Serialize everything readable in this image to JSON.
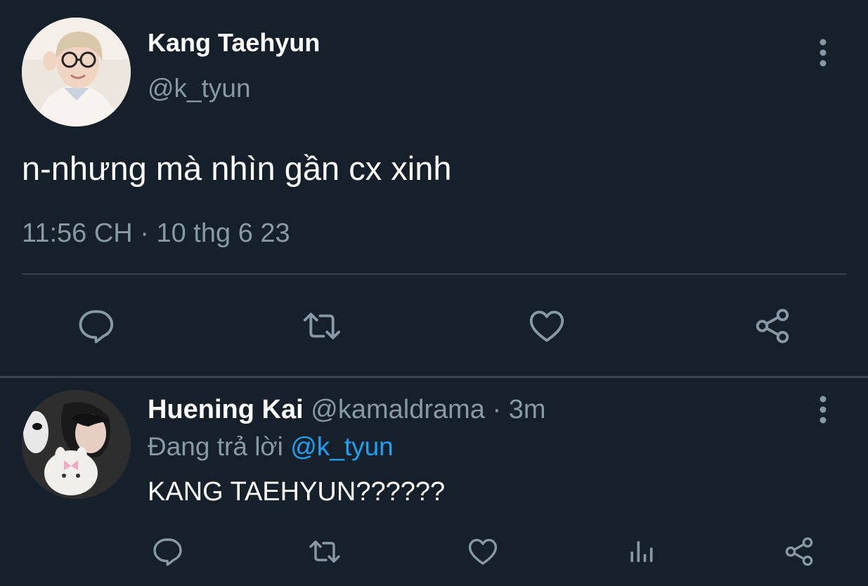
{
  "main_tweet": {
    "author_name": "Kang Taehyun",
    "author_handle": "@k_tyun",
    "text": "n-nhưng mà nhìn gần cx xinh",
    "timestamp": "11:56 CH · 10 thg 6 23",
    "avatar_icon": "user-photo-avatar",
    "actions": [
      "reply-icon",
      "retweet-icon",
      "like-icon",
      "share-icon"
    ]
  },
  "reply_tweet": {
    "author_name": "Huening Kai",
    "author_handle": "@kamaldrama",
    "separator": " · ",
    "time_ago": "3m",
    "replying_prefix": "Đang trả lời ",
    "replying_to": "@k_tyun",
    "text": "KANG TAEHYUN??????",
    "avatar_icon": "user-photo-avatar",
    "actions": [
      "reply-icon",
      "retweet-icon",
      "like-icon",
      "analytics-icon",
      "share-icon"
    ]
  },
  "colors": {
    "background": "#15202b",
    "primary_text": "#ffffff",
    "secondary_text": "#8899a6",
    "accent": "#1da1f2",
    "divider": "#38444d"
  }
}
